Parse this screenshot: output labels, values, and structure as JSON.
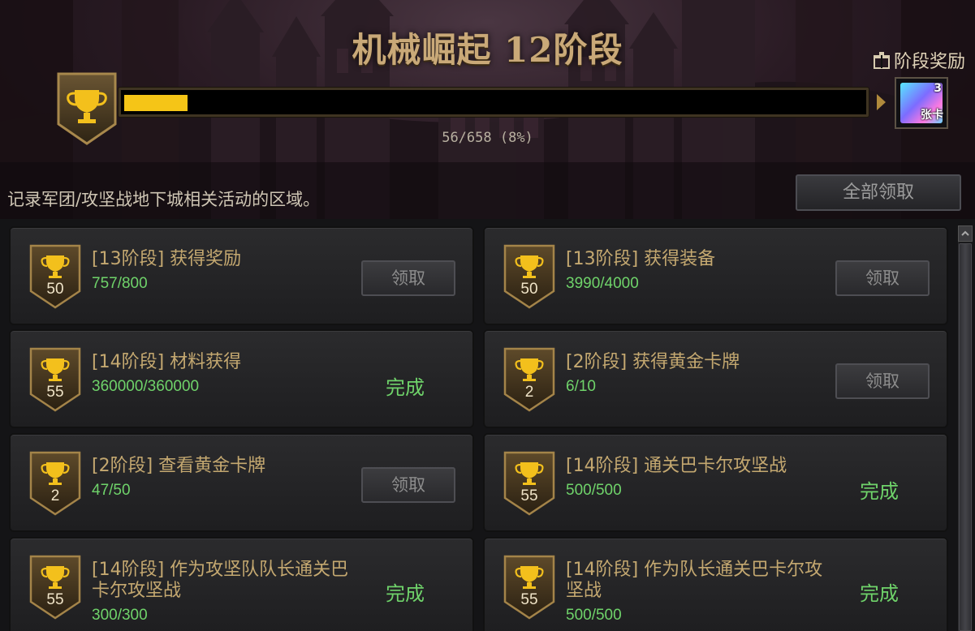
{
  "header": {
    "title": "机械崛起 12阶段",
    "stage_reward_label": "阶段奖励",
    "progress_text": "56/658 (8%)",
    "progress_fraction": 0.085,
    "reward_qty": "3",
    "reward_tag": "张卡",
    "description": "记录军团/攻坚战地下城相关活动的区域。",
    "claim_all_label": "全部领取"
  },
  "colors": {
    "accent_gold": "#f5c517",
    "title_gold": "#c9a978",
    "success_green": "#6fd36a"
  },
  "items": [
    {
      "points": "50",
      "title": "[13阶段] 获得奖励",
      "progress": "757/800",
      "status": "领取"
    },
    {
      "points": "50",
      "title": "[13阶段] 获得装备",
      "progress": "3990/4000",
      "status": "领取"
    },
    {
      "points": "55",
      "title": "[14阶段] 材料获得",
      "progress": "360000/360000",
      "status": "完成"
    },
    {
      "points": "2",
      "title": "[2阶段] 获得黄金卡牌",
      "progress": "6/10",
      "status": "领取"
    },
    {
      "points": "2",
      "title": "[2阶段] 查看黄金卡牌",
      "progress": "47/50",
      "status": "领取"
    },
    {
      "points": "55",
      "title": "[14阶段] 通关巴卡尔攻坚战",
      "progress": "500/500",
      "status": "完成"
    },
    {
      "points": "55",
      "title": "[14阶段] 作为攻坚队队长通关巴卡尔攻坚战",
      "progress": "300/300",
      "status": "完成"
    },
    {
      "points": "55",
      "title": "[14阶段] 作为队长通关巴卡尔攻坚战",
      "progress": "500/500",
      "status": "完成"
    }
  ]
}
